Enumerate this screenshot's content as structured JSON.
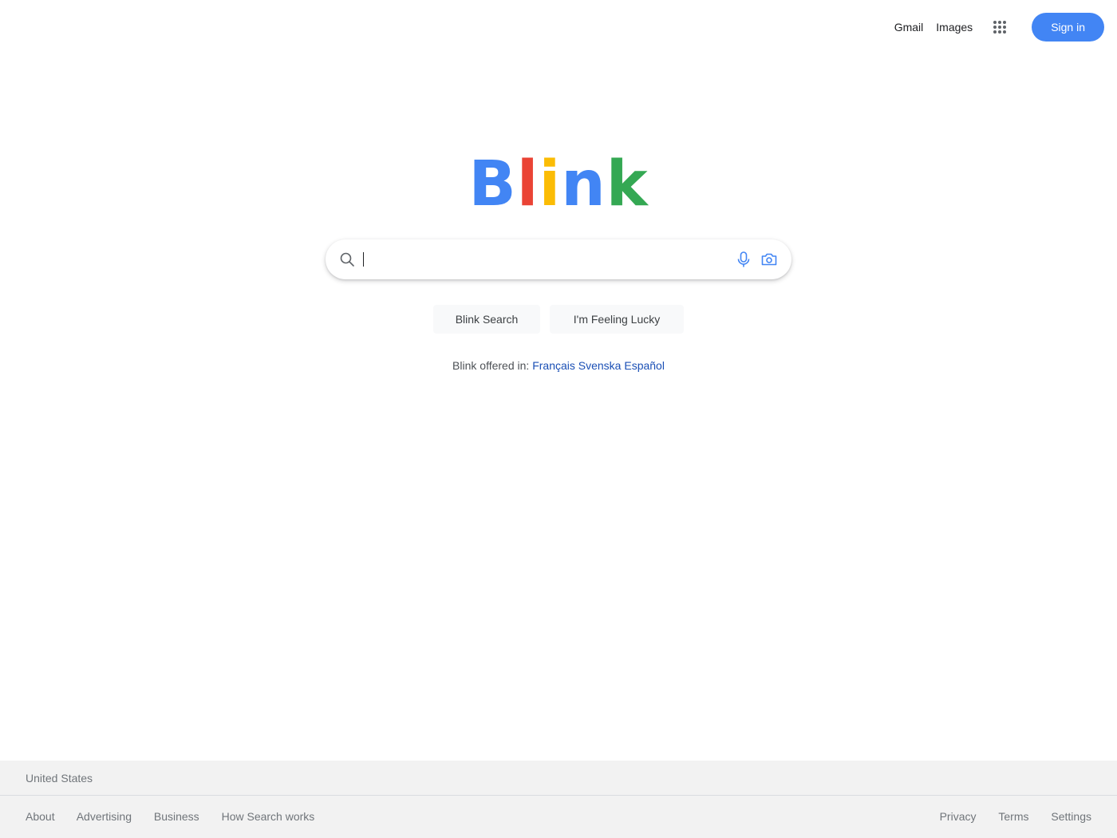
{
  "header": {
    "gmail_label": "Gmail",
    "images_label": "Images",
    "apps_icon": "apps-grid-icon",
    "sign_in_label": "Sign in"
  },
  "logo": {
    "letters": [
      {
        "char": "B",
        "color": "#4285f4"
      },
      {
        "char": "l",
        "color": "#ea4335"
      },
      {
        "char": "i",
        "color": "#fbbc05"
      },
      {
        "char": "n",
        "color": "#4285f4"
      },
      {
        "char": "k",
        "color": "#34a853"
      }
    ]
  },
  "search": {
    "value": "",
    "placeholder": "",
    "icons": [
      "search-icon",
      "mic-icon",
      "camera-icon"
    ]
  },
  "buttons": {
    "search_label": "Blink Search",
    "lucky_label": "I'm Feeling Lucky"
  },
  "languages": {
    "prefix": "Blink offered in:",
    "items": [
      "Français",
      "Svenska",
      "Español"
    ]
  },
  "footer": {
    "country": "United States",
    "left_links": [
      "About",
      "Advertising",
      "Business",
      "How Search works"
    ],
    "right_links": [
      "Privacy",
      "Terms",
      "Settings"
    ]
  },
  "colors": {
    "accent": "#4285f4",
    "link": "#1a4fb5",
    "footer_bg": "#f2f2f2"
  }
}
